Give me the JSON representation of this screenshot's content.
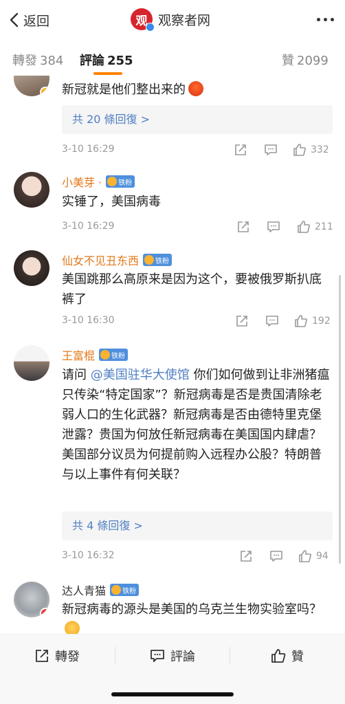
{
  "nav": {
    "back_label": "返回",
    "brand_logo_char": "观",
    "brand_name": "观察者网"
  },
  "tabs": [
    {
      "label": "轉發",
      "count": "384"
    },
    {
      "label": "評論",
      "count": "255"
    },
    {
      "label": "贊",
      "count": "2099"
    }
  ],
  "comments": [
    {
      "name": "",
      "text": "新冠就是他们整出来的",
      "emoji": "angry-emoji",
      "replies_label": "共 20 條回復 >",
      "time": "3-10 16:29",
      "likes": "332"
    },
    {
      "name": "小美芽 ·",
      "fan_badge": "铁粉",
      "text": "实锤了，美国病毒",
      "time": "3-10 16:29",
      "likes": "211"
    },
    {
      "name": "仙女不见丑东西",
      "fan_badge": "铁粉",
      "text": "美国跳那么高原来是因为这个，要被俄罗斯扒底裤了",
      "time": "3-10 16:30",
      "likes": "192"
    },
    {
      "name": "王富棍",
      "fan_badge": "铁粉",
      "text_prefix": "请问 ",
      "mention": "@美国驻华大使馆",
      "text": " 你们如何做到让非洲猪瘟只传染“特定国家”？新冠病毒是否是贵国清除老弱人口的生化武器？新冠病毒是否由德特里克堡泄露？贵国为何放任新冠病毒在美国国内肆虐？美国部分议员为何提前购入远程办公股？特朗普与以上事件有何关联？",
      "replies_label": "共 4 條回復 >",
      "time": "3-10 16:32",
      "likes": "94"
    },
    {
      "name": "达人青猫",
      "fan_badge": "铁粉",
      "text": "新冠病毒的源头是美国的乌克兰生物实验室吗？",
      "emoji": "smile-emoji"
    }
  ],
  "bottom_bar": {
    "repost_label": "轉發",
    "comment_label": "評論",
    "like_label": "贊"
  },
  "colors": {
    "accent": "#ff8200",
    "name_orange": "#e3791a",
    "link_blue": "#4f7fc2",
    "fan_badge_blue": "#4f8fdc",
    "brand_red": "#d6262d"
  }
}
